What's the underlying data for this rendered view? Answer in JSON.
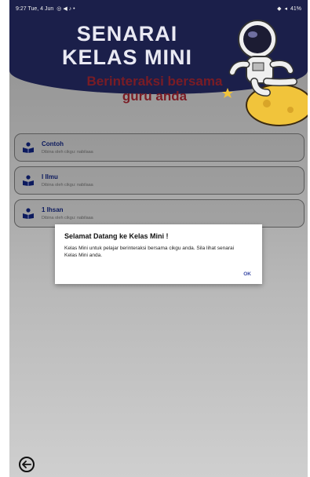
{
  "status_bar": {
    "time_date": "9:27  Tue, 4 Jun",
    "battery": "41%"
  },
  "header": {
    "title_line_1": "SENARAI",
    "title_line_2": "KELAS MINI",
    "subtitle_line_1": "Berinteraksi bersama",
    "subtitle_line_2": "guru anda"
  },
  "classes": [
    {
      "title": "Contoh",
      "subtitle": "Dibina oleh cikgu: nabilaaa"
    },
    {
      "title": "I Ilmu",
      "subtitle": "Dibina oleh cikgu: nabilaaa"
    },
    {
      "title": "1 Ihsan",
      "subtitle": "Dibina oleh cikgu: nabilaaa"
    }
  ],
  "dialog": {
    "title": "Selamat Datang ke Kelas Mini !",
    "message": "Kelas Mini untuk pelajar berinteraksi bersama cikgu anda. Sila lihat senarai Kelas Mini anda.",
    "ok_label": "OK"
  },
  "icons": {
    "class_icon": "book-person-icon",
    "back": "back-arrow-icon"
  },
  "colors": {
    "header_bg": "#1b1f4a",
    "subtitle": "#7a1c25",
    "card_title": "#0c1a5e",
    "dialog_ok": "#3b4ba6"
  }
}
